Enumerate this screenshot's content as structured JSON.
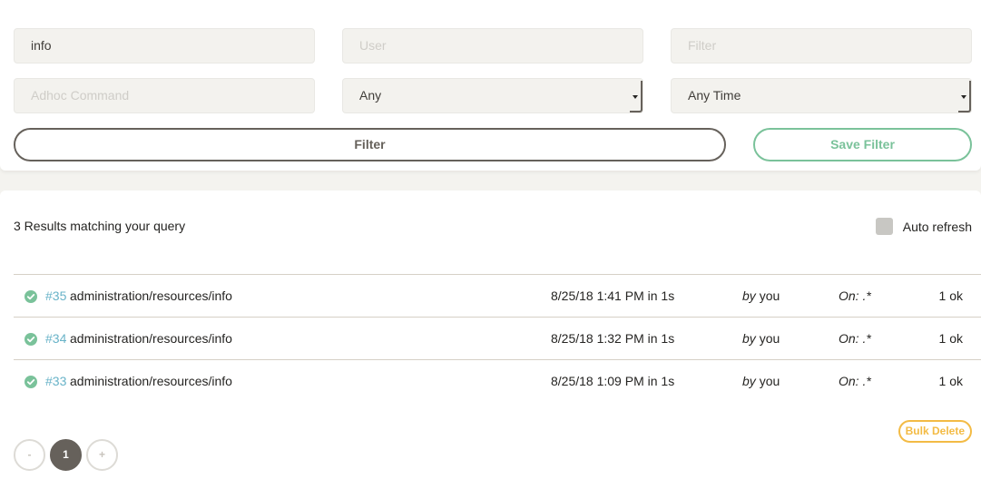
{
  "filters": {
    "job_name": {
      "value": "info",
      "placeholder": ""
    },
    "user": {
      "value": "",
      "placeholder": "User"
    },
    "filter": {
      "value": "",
      "placeholder": "Filter"
    },
    "adhoc_command": {
      "value": "",
      "placeholder": "Adhoc Command"
    },
    "status_select": {
      "selected": "Any"
    },
    "time_select": {
      "selected": "Any Time"
    },
    "filter_button": "Filter",
    "save_filter_button": "Save Filter"
  },
  "results": {
    "count_text": "3 Results matching your query",
    "auto_refresh_label": "Auto refresh",
    "auto_refresh_checked": false,
    "rows": [
      {
        "status_icon": "check-circle-icon",
        "number": "#35",
        "name": "administration/resources/info",
        "time": "8/25/18 1:41 PM in 1s",
        "by_prefix": "by",
        "by_user": "you",
        "on": "On: .*",
        "result": "1 ok"
      },
      {
        "status_icon": "check-circle-icon",
        "number": "#34",
        "name": "administration/resources/info",
        "time": "8/25/18 1:32 PM in 1s",
        "by_prefix": "by",
        "by_user": "you",
        "on": "On: .*",
        "result": "1 ok"
      },
      {
        "status_icon": "check-circle-icon",
        "number": "#33",
        "name": "administration/resources/info",
        "time": "8/25/18 1:09 PM in 1s",
        "by_prefix": "by",
        "by_user": "you",
        "on": "On: .*",
        "result": "1 ok"
      }
    ],
    "bulk_delete_button": "Bulk Delete"
  },
  "pagination": {
    "prev": "-",
    "current": "1",
    "next": "+"
  },
  "colors": {
    "success": "#7ac29a",
    "info": "#68b3c8",
    "warning": "#f3bb45",
    "neutral": "#66615b"
  }
}
